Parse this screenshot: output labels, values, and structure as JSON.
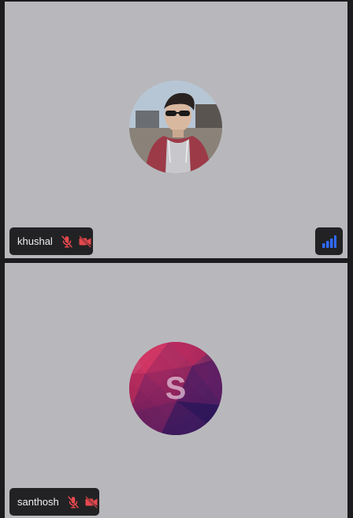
{
  "participants": [
    {
      "name": "khushal",
      "avatar": "photo",
      "mic_icon": "mic-off-icon",
      "camera_icon": "video-off-icon",
      "show_signal": true,
      "signal_icon": "signal-bars-icon"
    },
    {
      "name": "santhosh",
      "avatar": "initial",
      "initial": "S",
      "mic_icon": "mic-off-icon",
      "camera_icon": "video-off-icon",
      "show_signal": false
    }
  ],
  "colors": {
    "muted_red": "#e5484d",
    "signal_blue": "#2f6bff",
    "tile_bg": "#b8b8bc",
    "chip_bg": "#222224"
  }
}
